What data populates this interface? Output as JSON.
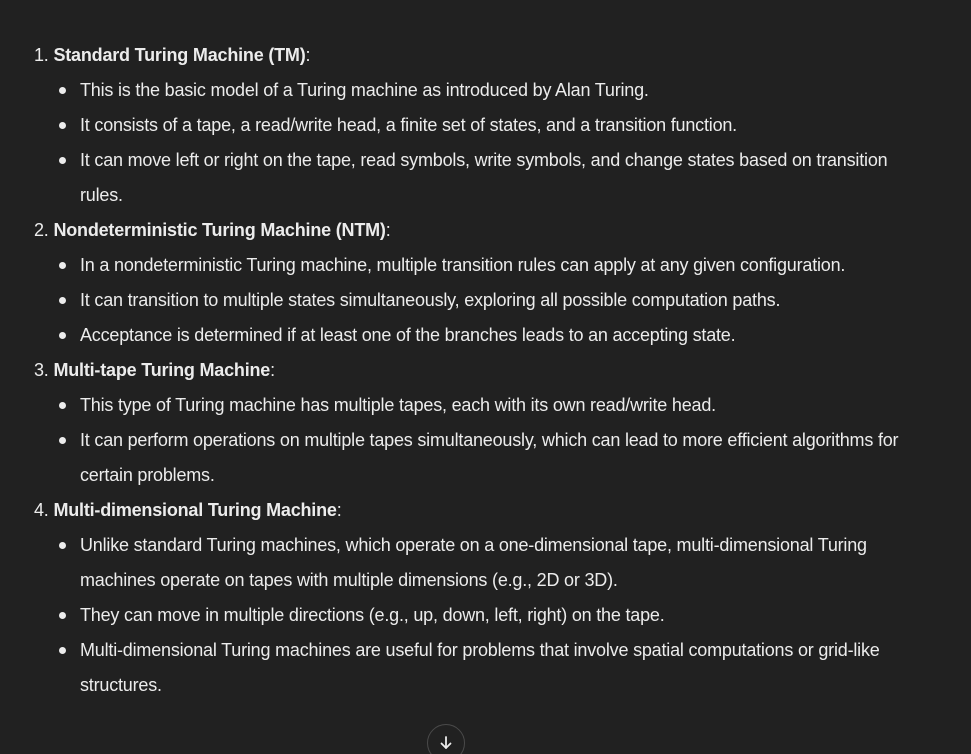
{
  "sections": [
    {
      "number": "1.",
      "title": "Standard Turing Machine (TM)",
      "suffix": ":",
      "bullets": [
        "This is the basic model of a Turing machine as introduced by Alan Turing.",
        "It consists of a tape, a read/write head, a finite set of states, and a transition function.",
        "It can move left or right on the tape, read symbols, write symbols, and change states based on transition rules."
      ]
    },
    {
      "number": "2.",
      "title": "Nondeterministic Turing Machine (NTM)",
      "suffix": ":",
      "bullets": [
        "In a nondeterministic Turing machine, multiple transition rules can apply at any given configuration.",
        "It can transition to multiple states simultaneously, exploring all possible computation paths.",
        "Acceptance is determined if at least one of the branches leads to an accepting state."
      ]
    },
    {
      "number": "3.",
      "title": "Multi-tape Turing Machine",
      "suffix": ":",
      "bullets": [
        "This type of Turing machine has multiple tapes, each with its own read/write head.",
        "It can perform operations on multiple tapes simultaneously, which can lead to more efficient algorithms for certain problems."
      ]
    },
    {
      "number": "4.",
      "title": "Multi-dimensional Turing Machine",
      "suffix": ":",
      "bullets": [
        "Unlike standard Turing machines, which operate on a one-dimensional tape, multi-dimensional Turing machines operate on tapes with multiple dimensions (e.g., 2D or 3D).",
        "They can move in multiple directions (e.g., up, down, left, right) on the tape.",
        "Multi-dimensional Turing machines are useful for problems that involve spatial computations or grid-like structures."
      ]
    }
  ],
  "scroll_button": {
    "icon": "arrow-down-icon"
  },
  "colors": {
    "background": "#212121",
    "text": "#ececec"
  }
}
